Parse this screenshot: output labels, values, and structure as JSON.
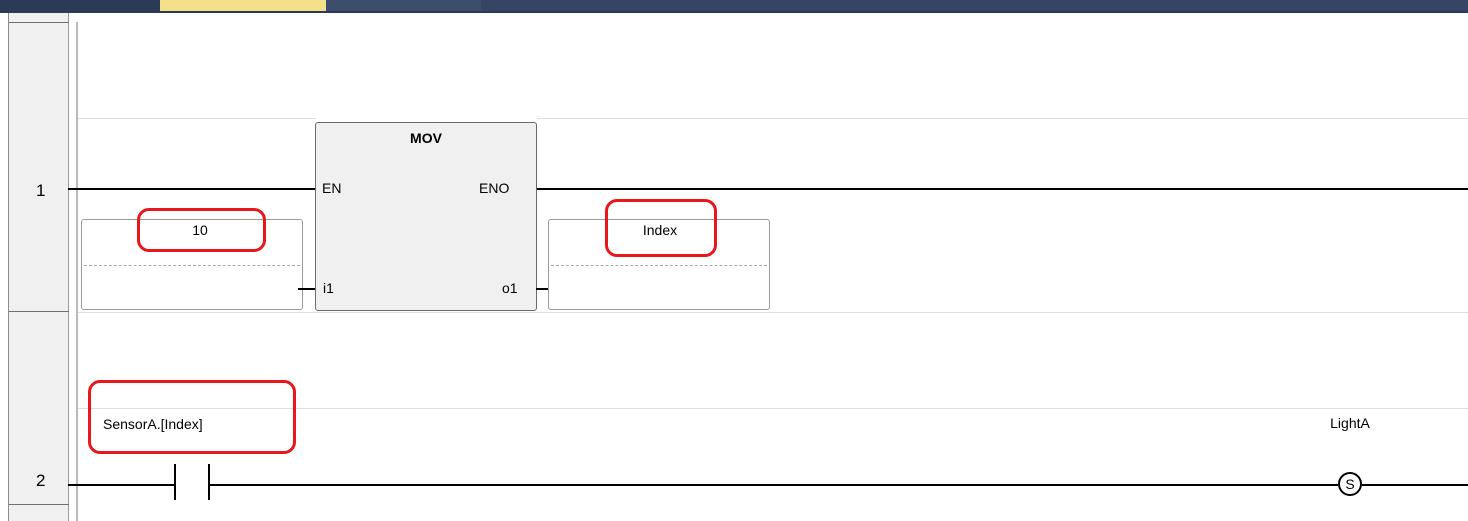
{
  "colors": {
    "title_bar": "#2b3a55",
    "active_tab": "#f5e08a",
    "highlight": "#e8181a",
    "wire": "#000000",
    "function_block_fill": "#f0f0f0"
  },
  "rungs": [
    {
      "number": "1",
      "function_block": {
        "name": "MOV",
        "inputs": [
          "EN",
          "i1"
        ],
        "outputs": [
          "ENO",
          "o1"
        ]
      },
      "input_operand": "10",
      "output_operand": "Index"
    },
    {
      "number": "2",
      "contact": {
        "variable": "SensorA.[Index]"
      },
      "coil": {
        "variable": "LightA",
        "symbol": "S"
      }
    }
  ]
}
